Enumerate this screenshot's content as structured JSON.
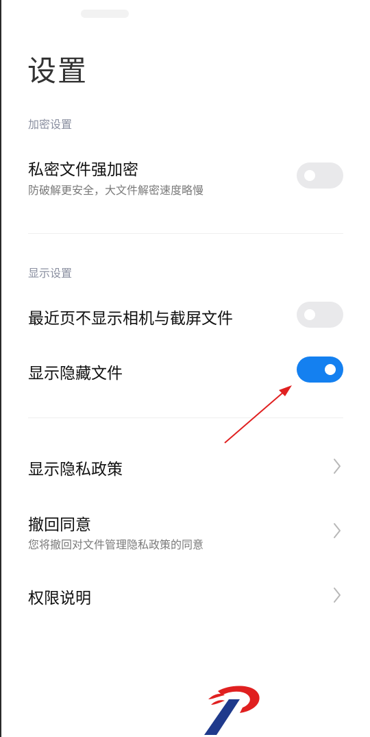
{
  "page": {
    "title": "设置"
  },
  "sections": {
    "encryption": {
      "header": "加密设置",
      "items": [
        {
          "title": "私密文件强加密",
          "subtitle": "防破解更安全，大文件解密速度略慢",
          "toggle": false
        }
      ]
    },
    "display": {
      "header": "显示设置",
      "items": [
        {
          "title": "最近页不显示相机与截屏文件",
          "toggle": false
        },
        {
          "title": "显示隐藏文件",
          "toggle": true
        }
      ]
    },
    "links": {
      "items": [
        {
          "title": "显示隐私政策"
        },
        {
          "title": "撤回同意",
          "subtitle": "您将撤回对文件管理隐私政策的同意"
        },
        {
          "title": "权限说明"
        }
      ]
    }
  },
  "colors": {
    "accent": "#1480f0",
    "annotation_arrow": "#e02020",
    "logo_red": "#e02020",
    "logo_blue": "#1f3a8c"
  },
  "icons": [
    "chevron-right-icon",
    "annotation-arrow",
    "watermark-logo"
  ]
}
